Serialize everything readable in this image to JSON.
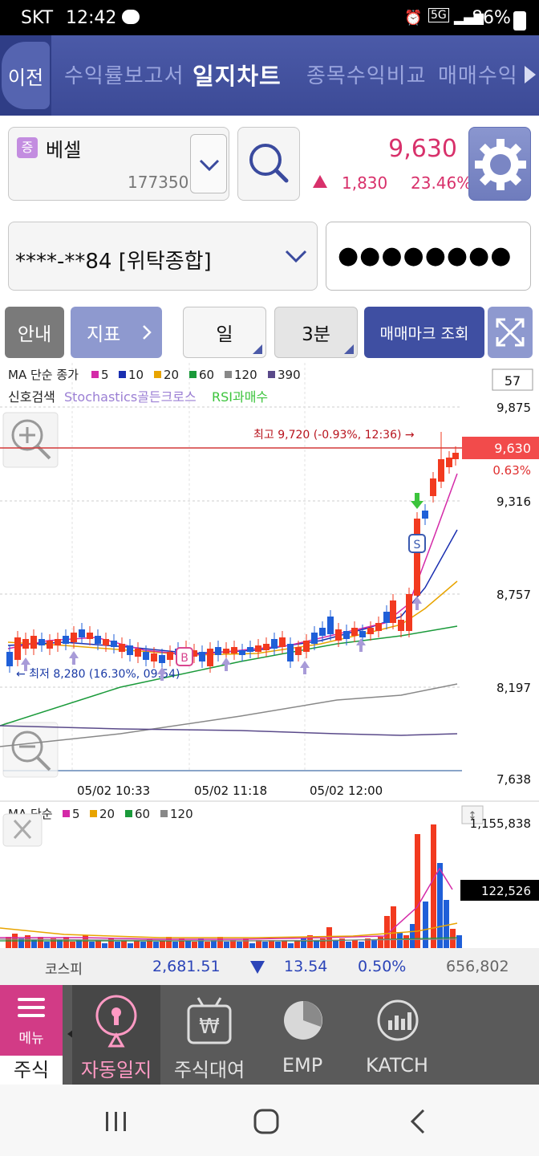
{
  "status_bar": {
    "carrier": "SKT",
    "time": "12:42",
    "network": "5G",
    "battery": "86%"
  },
  "top_nav": {
    "prev_label": "이전",
    "tabs": [
      {
        "label": "수익률보고서",
        "active": false
      },
      {
        "label": "일지차트",
        "active": true
      },
      {
        "label": "종목수익비교",
        "active": false
      },
      {
        "label": "매매수익",
        "active": false
      }
    ]
  },
  "stock": {
    "badge": "증",
    "name": "베셀",
    "code": "177350",
    "price": "9,630",
    "change": "1,830",
    "change_pct": "23.46%",
    "direction": "up"
  },
  "account": {
    "number": "****-**84 [위탁종합]",
    "password_mask": "●●●●●●●●"
  },
  "controls": {
    "guide": "안내",
    "indicator": "지표",
    "period": "일",
    "interval": "3분",
    "trade_mark": "매매마크 조회"
  },
  "price_chart": {
    "legend_label": "MA 단순 종가",
    "ma_legend": [
      {
        "period": "5",
        "color": "#d42aa8"
      },
      {
        "period": "10",
        "color": "#1a2fb0"
      },
      {
        "period": "20",
        "color": "#e8a400"
      },
      {
        "period": "60",
        "color": "#1a9a3a"
      },
      {
        "period": "120",
        "color": "#888888"
      },
      {
        "period": "390",
        "color": "#5a4a8a"
      }
    ],
    "signal_label": "신호검색",
    "signal_stoch": "Stochastics골든크로스",
    "signal_rsi": "RSI과매수",
    "count_box": "57",
    "y_ticks": [
      "9,875",
      "9,316",
      "8,757",
      "8,197",
      "7,638"
    ],
    "current_price": "9,630",
    "current_pct": "0.63%",
    "high_note": "최고 9,720 (-0.93%, 12:36) →",
    "low_note": "← 최저 8,280 (16.30%, 09:54)",
    "x_labels": [
      "05/02 10:33",
      "05/02 11:18",
      "05/02 12:00"
    ],
    "buy_mark": "B",
    "sell_mark": "S"
  },
  "volume_chart": {
    "legend_label": "MA 단순",
    "ma_legend": [
      {
        "period": "5",
        "color": "#d42aa8"
      },
      {
        "period": "20",
        "color": "#e8a400"
      },
      {
        "period": "60",
        "color": "#1a9a3a"
      },
      {
        "period": "120",
        "color": "#888888"
      }
    ],
    "y_max": "1,155,838",
    "current_volume": "122,526"
  },
  "kospi": {
    "name": "코스피",
    "value": "2,681.51",
    "change": "13.54",
    "pct": "0.50%",
    "volume": "656,802"
  },
  "bottom_nav": {
    "menu_label": "메뉴",
    "stock_label": "주식",
    "items": [
      "자동일지",
      "주식대여",
      "EMP",
      "KATCH"
    ]
  },
  "colors": {
    "up": "#f23a1f",
    "down": "#1f5fd8",
    "accent": "#3f4fa2",
    "price_pink": "#d8316b"
  },
  "icons": [
    "search-icon",
    "gear-icon",
    "chevron-down-icon",
    "expand-icon",
    "zoom-in-icon",
    "zoom-out-icon",
    "close-icon",
    "menu-icon",
    "keyhole-icon",
    "won-icon",
    "pie-icon",
    "chart-icon"
  ]
}
